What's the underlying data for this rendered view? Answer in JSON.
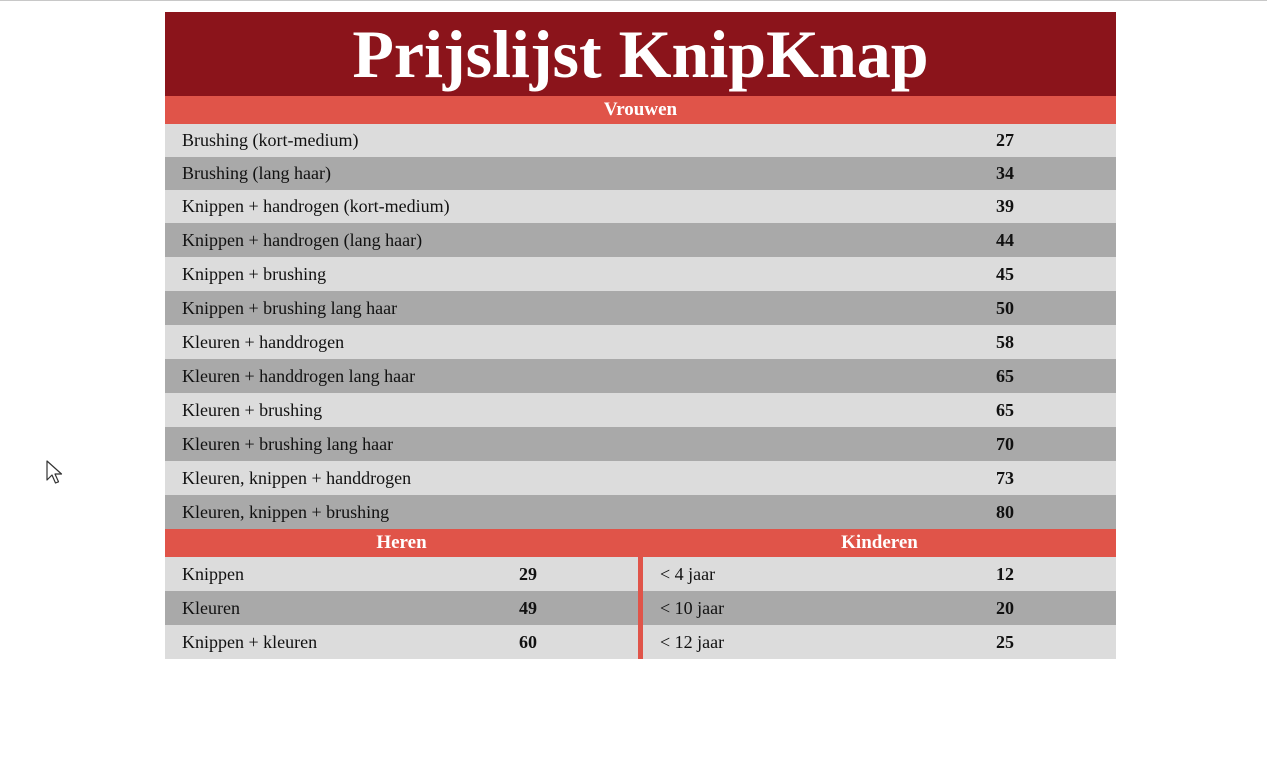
{
  "title": "Prijslijst KnipKnap",
  "colors": {
    "title_bg": "#8b141b",
    "section_bg": "#e05449",
    "row_light": "#dcdcdc",
    "row_dark": "#a9a9a9"
  },
  "vrouwen": {
    "heading": "Vrouwen",
    "items": [
      {
        "label": "Brushing (kort-medium)",
        "price": "27"
      },
      {
        "label": "Brushing (lang haar)",
        "price": "34"
      },
      {
        "label": "Knippen + handrogen (kort-medium)",
        "price": "39"
      },
      {
        "label": "Knippen + handrogen (lang haar)",
        "price": "44"
      },
      {
        "label": "Knippen + brushing",
        "price": "45"
      },
      {
        "label": "Knippen + brushing lang haar",
        "price": "50"
      },
      {
        "label": "Kleuren + handdrogen",
        "price": "58"
      },
      {
        "label": "Kleuren + handdrogen lang haar",
        "price": "65"
      },
      {
        "label": "Kleuren + brushing",
        "price": "65"
      },
      {
        "label": "Kleuren + brushing lang haar",
        "price": "70"
      },
      {
        "label": "Kleuren, knippen + handdrogen",
        "price": "73"
      },
      {
        "label": "Kleuren, knippen + brushing",
        "price": "80"
      }
    ]
  },
  "heren": {
    "heading": "Heren",
    "items": [
      {
        "label": "Knippen",
        "price": "29"
      },
      {
        "label": "Kleuren",
        "price": "49"
      },
      {
        "label": "Knippen + kleuren",
        "price": "60"
      }
    ]
  },
  "kinderen": {
    "heading": "Kinderen",
    "items": [
      {
        "label": "< 4 jaar",
        "price": "12"
      },
      {
        "label": "< 10 jaar",
        "price": "20"
      },
      {
        "label": "< 12 jaar",
        "price": "25"
      }
    ]
  }
}
